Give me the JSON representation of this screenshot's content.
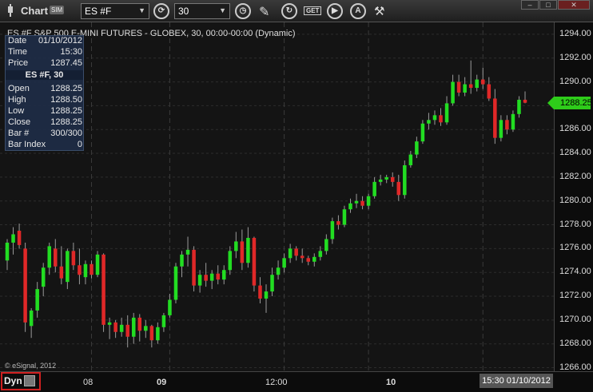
{
  "window": {
    "title": "Chart",
    "sim_badge": "SIM"
  },
  "toolbar": {
    "symbol": "ES #F",
    "interval": "30",
    "icons": [
      "refresh-icon",
      "clock-icon",
      "draw-pencil-icon",
      "reload-icon",
      "get-icon",
      "play-icon",
      "alert-icon",
      "tools-icon"
    ],
    "get_label": "GET",
    "window_buttons": [
      "minimize",
      "maximize",
      "close"
    ]
  },
  "study_title": "ES #F S&P 500 E-MINI FUTURES - GLOBEX, 30, 00:00-00:00 (Dynamic)",
  "info_panel": {
    "date_key": "Date",
    "date_val": "01/10/2012",
    "time_key": "Time",
    "time_val": "15:30",
    "price_key": "Price",
    "price_val": "1287.45",
    "section": "ES #F, 30",
    "open_key": "Open",
    "open_val": "1288.25",
    "high_key": "High",
    "high_val": "1288.50",
    "low_key": "Low",
    "low_val": "1288.25",
    "close_key": "Close",
    "close_val": "1288.25",
    "bar_key": "Bar #",
    "bar_val": "300/300",
    "barindex_key": "Bar Index",
    "barindex_val": "0"
  },
  "copyright": "© eSignal, 2012",
  "footer": {
    "dyn": "Dyn",
    "cursor_time": "15:30 01/10/2012"
  },
  "colors": {
    "up": "#22dd22",
    "down": "#e02828",
    "grid": "#2c2c2c",
    "last_price": "#2ecc1a"
  },
  "chart_data": {
    "type": "candlestick",
    "symbol": "ES #F",
    "interval": "30",
    "last_price": "1288.25",
    "y_ticks": [
      "1294.00",
      "1292.00",
      "1290.00",
      "1288.00",
      "1286.00",
      "1284.00",
      "1282.00",
      "1280.00",
      "1278.00",
      "1276.00",
      "1274.00",
      "1272.00",
      "1270.00",
      "1268.00",
      "1266.00"
    ],
    "ylim": [
      1265.7,
      1295.0
    ],
    "x_ticks": [
      "08",
      "09",
      "12:00",
      "10"
    ],
    "x_ticks_bold": [
      false,
      true,
      false,
      true
    ],
    "grid": true,
    "candles": [
      [
        1275.0,
        1276.8,
        1274.2,
        1276.5
      ],
      [
        1276.5,
        1277.8,
        1275.5,
        1277.2
      ],
      [
        1277.5,
        1278.1,
        1276.0,
        1276.3
      ],
      [
        1276.0,
        1276.5,
        1269.0,
        1269.8
      ],
      [
        1269.5,
        1271.0,
        1268.5,
        1270.8
      ],
      [
        1270.8,
        1273.2,
        1270.2,
        1272.6
      ],
      [
        1272.8,
        1274.8,
        1272.0,
        1274.4
      ],
      [
        1274.4,
        1276.5,
        1273.8,
        1276.2
      ],
      [
        1276.0,
        1276.8,
        1274.0,
        1274.5
      ],
      [
        1274.5,
        1276.2,
        1273.0,
        1273.5
      ],
      [
        1273.2,
        1276.0,
        1272.6,
        1275.8
      ],
      [
        1275.8,
        1276.5,
        1274.2,
        1274.6
      ],
      [
        1274.6,
        1276.0,
        1273.0,
        1273.8
      ],
      [
        1273.6,
        1275.0,
        1273.0,
        1274.7
      ],
      [
        1274.7,
        1275.0,
        1273.5,
        1273.8
      ],
      [
        1273.8,
        1275.8,
        1273.6,
        1275.5
      ],
      [
        1275.5,
        1275.6,
        1269.0,
        1269.6
      ],
      [
        1269.6,
        1270.2,
        1268.4,
        1269.8
      ],
      [
        1269.8,
        1270.0,
        1268.5,
        1269.0
      ],
      [
        1269.0,
        1270.2,
        1268.6,
        1269.6
      ],
      [
        1269.6,
        1270.4,
        1267.7,
        1268.6
      ],
      [
        1268.6,
        1270.6,
        1268.0,
        1270.2
      ],
      [
        1270.2,
        1270.5,
        1268.2,
        1269.1
      ],
      [
        1269.1,
        1270.0,
        1268.5,
        1269.5
      ],
      [
        1269.5,
        1269.6,
        1267.7,
        1268.3
      ],
      [
        1268.3,
        1269.8,
        1268.0,
        1269.4
      ],
      [
        1269.4,
        1270.6,
        1269.0,
        1270.4
      ],
      [
        1270.4,
        1272.2,
        1270.2,
        1271.7
      ],
      [
        1271.7,
        1274.8,
        1271.4,
        1274.5
      ],
      [
        1274.5,
        1275.8,
        1273.6,
        1275.5
      ],
      [
        1275.5,
        1277.0,
        1274.5,
        1275.9
      ],
      [
        1275.9,
        1276.2,
        1272.4,
        1272.9
      ],
      [
        1272.9,
        1274.2,
        1272.3,
        1273.8
      ],
      [
        1273.8,
        1274.8,
        1272.8,
        1273.3
      ],
      [
        1273.3,
        1274.2,
        1272.6,
        1273.9
      ],
      [
        1273.9,
        1274.6,
        1273.0,
        1273.4
      ],
      [
        1273.4,
        1274.6,
        1273.0,
        1274.2
      ],
      [
        1274.2,
        1276.2,
        1273.8,
        1275.8
      ],
      [
        1275.8,
        1277.4,
        1275.2,
        1276.6
      ],
      [
        1276.6,
        1277.6,
        1274.2,
        1274.8
      ],
      [
        1274.8,
        1277.8,
        1274.4,
        1276.9
      ],
      [
        1276.9,
        1277.0,
        1272.4,
        1272.9
      ],
      [
        1272.9,
        1273.6,
        1271.4,
        1271.8
      ],
      [
        1271.8,
        1273.0,
        1270.6,
        1272.4
      ],
      [
        1272.4,
        1274.4,
        1272.0,
        1273.8
      ],
      [
        1273.8,
        1275.0,
        1273.4,
        1274.4
      ],
      [
        1274.4,
        1275.6,
        1274.0,
        1275.2
      ],
      [
        1275.2,
        1276.4,
        1274.8,
        1276.0
      ],
      [
        1276.0,
        1276.2,
        1275.0,
        1275.4
      ],
      [
        1275.4,
        1276.0,
        1274.8,
        1275.2
      ],
      [
        1275.2,
        1275.4,
        1274.6,
        1274.9
      ],
      [
        1274.9,
        1275.6,
        1274.5,
        1275.3
      ],
      [
        1275.3,
        1276.2,
        1275.0,
        1275.8
      ],
      [
        1275.8,
        1277.2,
        1275.5,
        1276.8
      ],
      [
        1276.8,
        1278.6,
        1276.4,
        1278.3
      ],
      [
        1278.3,
        1278.8,
        1277.6,
        1278.0
      ],
      [
        1278.0,
        1279.6,
        1277.8,
        1279.3
      ],
      [
        1279.3,
        1280.2,
        1279.0,
        1279.8
      ],
      [
        1279.8,
        1280.6,
        1279.4,
        1280.0
      ],
      [
        1280.0,
        1280.4,
        1279.3,
        1279.6
      ],
      [
        1279.6,
        1280.6,
        1279.3,
        1280.4
      ],
      [
        1280.4,
        1282.0,
        1280.2,
        1281.6
      ],
      [
        1281.6,
        1282.2,
        1281.3,
        1281.8
      ],
      [
        1281.8,
        1282.2,
        1281.5,
        1282.0
      ],
      [
        1282.0,
        1282.4,
        1281.2,
        1281.6
      ],
      [
        1281.6,
        1282.2,
        1280.0,
        1280.5
      ],
      [
        1280.5,
        1283.4,
        1280.2,
        1283.0
      ],
      [
        1283.0,
        1284.2,
        1282.8,
        1283.9
      ],
      [
        1283.9,
        1285.4,
        1283.6,
        1285.0
      ],
      [
        1285.0,
        1286.8,
        1284.8,
        1286.5
      ],
      [
        1286.5,
        1287.4,
        1286.0,
        1286.8
      ],
      [
        1286.8,
        1287.6,
        1286.4,
        1287.2
      ],
      [
        1287.2,
        1287.8,
        1286.3,
        1286.6
      ],
      [
        1286.6,
        1288.8,
        1286.4,
        1288.2
      ],
      [
        1288.2,
        1290.6,
        1288.0,
        1290.0
      ],
      [
        1290.0,
        1290.6,
        1288.8,
        1289.1
      ],
      [
        1289.1,
        1290.4,
        1288.8,
        1289.8
      ],
      [
        1289.8,
        1291.8,
        1289.0,
        1289.5
      ],
      [
        1289.5,
        1290.6,
        1289.2,
        1290.2
      ],
      [
        1290.2,
        1291.2,
        1289.4,
        1289.8
      ],
      [
        1289.8,
        1290.4,
        1288.4,
        1288.6
      ],
      [
        1288.6,
        1289.4,
        1284.8,
        1285.3
      ],
      [
        1285.3,
        1287.2,
        1285.0,
        1286.8
      ],
      [
        1286.8,
        1287.2,
        1285.6,
        1286.0
      ],
      [
        1286.0,
        1287.6,
        1285.8,
        1287.3
      ],
      [
        1287.3,
        1288.8,
        1287.0,
        1288.5
      ],
      [
        1288.5,
        1289.2,
        1288.2,
        1288.25
      ]
    ]
  }
}
